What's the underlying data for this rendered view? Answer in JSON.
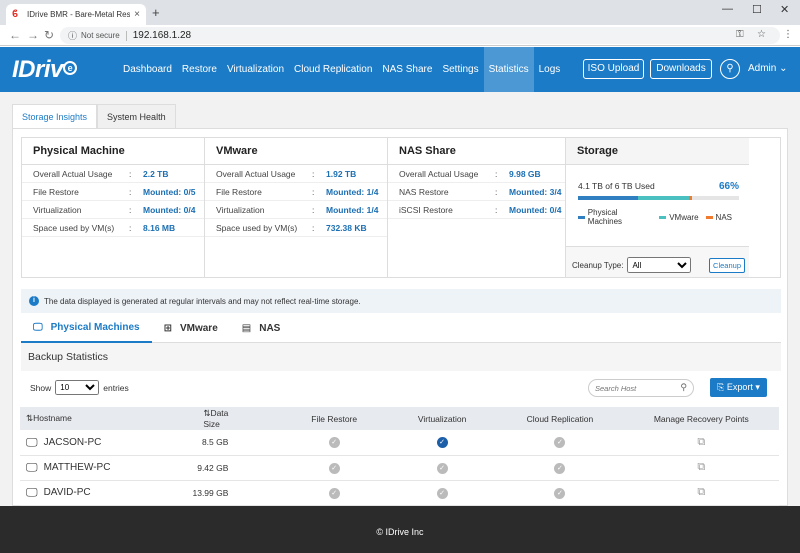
{
  "browser": {
    "tab_title": "IDrive BMR - Bare-Metal Restore",
    "tab_close": "×",
    "new_tab": "+",
    "not_secure": "Not secure",
    "url": "192.168.1.28"
  },
  "nav": {
    "logo": "IDriv",
    "logo_e": "e",
    "menu": [
      "Dashboard",
      "Restore",
      "Virtualization",
      "Cloud Replication",
      "NAS Share",
      "Settings",
      "Statistics",
      "Logs"
    ],
    "active": "Statistics",
    "iso_upload": "ISO Upload",
    "downloads": "Downloads",
    "admin": "Admin"
  },
  "subtabs": [
    "Storage Insights",
    "System Health"
  ],
  "summary": {
    "physical": {
      "title": "Physical Machine",
      "rows": [
        {
          "label": "Overall Actual Usage",
          "value": "2.2 TB"
        },
        {
          "label": "File Restore",
          "value": "Mounted: 0/5"
        },
        {
          "label": "Virtualization",
          "value": "Mounted: 0/4"
        },
        {
          "label": "Space used by VM(s)",
          "value": "8.16 MB"
        }
      ]
    },
    "vmware": {
      "title": "VMware",
      "rows": [
        {
          "label": "Overall Actual Usage",
          "value": "1.92 TB"
        },
        {
          "label": "File Restore",
          "value": "Mounted: 1/4"
        },
        {
          "label": "Virtualization",
          "value": "Mounted: 1/4"
        },
        {
          "label": "Space used by VM(s)",
          "value": "732.38 KB"
        }
      ]
    },
    "nas": {
      "title": "NAS Share",
      "rows": [
        {
          "label": "Overall Actual Usage",
          "value": "9.98 GB"
        },
        {
          "label": "NAS Restore",
          "value": "Mounted: 3/4"
        },
        {
          "label": "iSCSI Restore",
          "value": "Mounted: 0/4"
        }
      ]
    },
    "colon": ":"
  },
  "storage": {
    "title": "Storage",
    "used_text": "4.1 TB of 6 TB Used",
    "percent": "66%",
    "legend": [
      "Physical Machines",
      "VMware",
      "NAS"
    ],
    "colors": {
      "physical": "#2f7fc1",
      "vmware": "#4bc0c0",
      "nas": "#f07b2f"
    },
    "fractions": {
      "physical": 0.37,
      "vmware": 0.32,
      "nas": 0.02
    },
    "cleanup_label": "Cleanup Type:",
    "cleanup_value": "All",
    "cleanup_button": "Cleanup"
  },
  "info": "The data displayed is generated at regular intervals and may not reflect real-time storage.",
  "data_tabs": [
    "Physical Machines",
    "VMware",
    "NAS"
  ],
  "backup_title": "Backup Statistics",
  "show": {
    "label": "Show",
    "value": "10",
    "suffix": "entries"
  },
  "search_placeholder": "Search Host",
  "export_label": "Export",
  "table": {
    "headers": [
      "Hostname",
      "Data Size",
      "File Restore",
      "Virtualization",
      "Cloud Replication",
      "Manage Recovery Points"
    ],
    "rows": [
      {
        "host": "JACSON-PC",
        "size": "8.5 GB",
        "file_restore": false,
        "virtualization": true,
        "cloud": false
      },
      {
        "host": "MATTHEW-PC",
        "size": "9.42 GB",
        "file_restore": false,
        "virtualization": false,
        "cloud": false
      },
      {
        "host": "DAVID-PC",
        "size": "13.99 GB",
        "file_restore": false,
        "virtualization": false,
        "cloud": false
      }
    ]
  },
  "footer": "© IDrive Inc"
}
